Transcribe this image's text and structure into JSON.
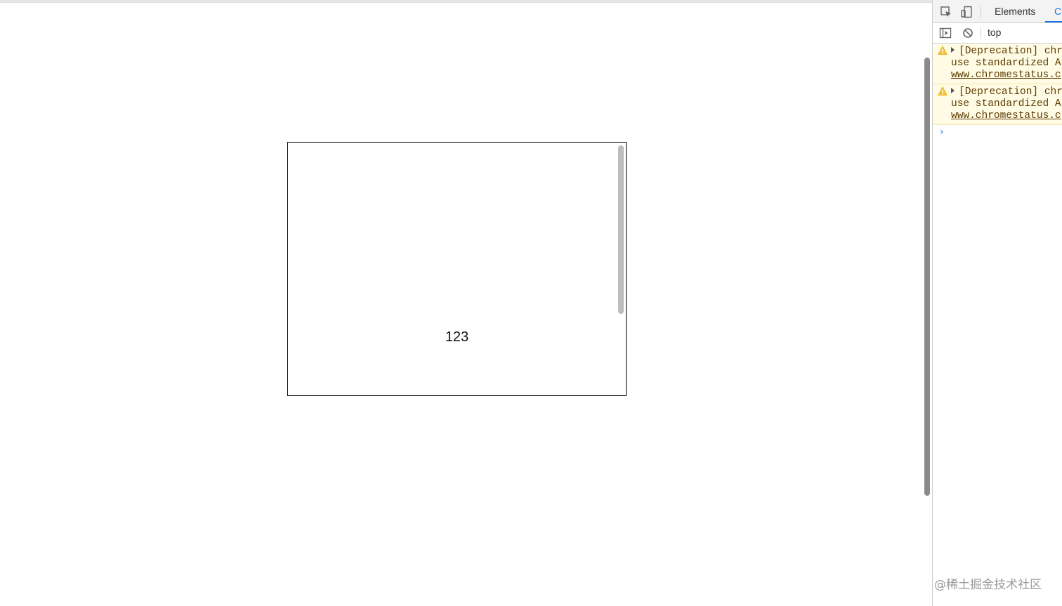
{
  "page": {
    "demo_text": "123"
  },
  "devtools": {
    "tabs": [
      {
        "label": "Elements",
        "active": false
      },
      {
        "label": "C",
        "active": true
      }
    ],
    "context": "top",
    "console_messages": [
      {
        "level": "warning",
        "line1": "[Deprecation] chr",
        "line2": "use standardized A",
        "line3": "www.chromestatus.c"
      },
      {
        "level": "warning",
        "line1": "[Deprecation] chr",
        "line2": "use standardized A",
        "line3": "www.chromestatus.c"
      }
    ],
    "prompt_symbol": "›"
  },
  "watermark": "@稀土掘金技术社区",
  "colors": {
    "accent": "#1a73e8",
    "warning_bg": "#fffbe5",
    "warning_icon": "#e8a700"
  },
  "icons": {
    "inspect": "inspect-element-icon",
    "device": "device-toolbar-icon",
    "sidebar": "show-sidebar-icon",
    "clear": "clear-console-icon",
    "warning": "warning-icon"
  }
}
